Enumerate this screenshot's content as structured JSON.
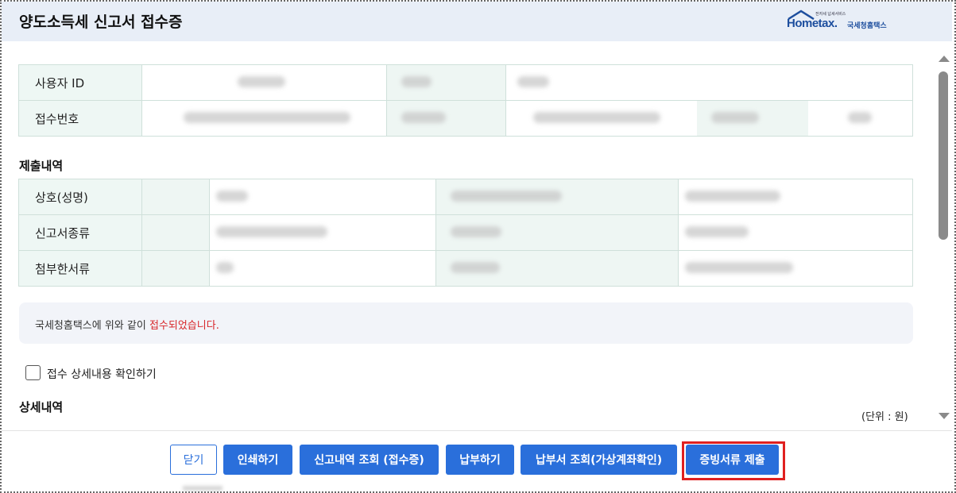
{
  "window": {
    "title": "양도소득세 신고서 접수증"
  },
  "logo": {
    "tiny_text": "전자세 납세서비스",
    "main": "Hometax.",
    "sub": "국세청홈택스"
  },
  "user_table": {
    "rows": [
      {
        "label": "사용자 ID"
      },
      {
        "label": "접수번호"
      }
    ]
  },
  "submission": {
    "title": "제출내역",
    "rows": [
      {
        "label": "상호(성명)"
      },
      {
        "label": "신고서종류"
      },
      {
        "label": "첨부한서류"
      }
    ]
  },
  "notice": {
    "prefix": "국세청홈택스에 위와 같이 ",
    "highlight": "접수되었습니다.",
    "highlight_color": "#d8262a"
  },
  "checkbox": {
    "label": "접수 상세내용 확인하기",
    "checked": false
  },
  "detail": {
    "title": "상세내역",
    "unit": "(단위 : 원)"
  },
  "buttons": {
    "close": "닫기",
    "print": "인쇄하기",
    "history": "신고내역 조회 (접수증)",
    "pay": "납부하기",
    "bill": "납부서 조회(가상계좌확인)",
    "submit_docs": "증빙서류 제출"
  },
  "colors": {
    "primary": "#2a6fdb",
    "header_bg": "#e8eef7",
    "label_bg": "#eef7f4",
    "highlight_border": "#e0201f"
  }
}
